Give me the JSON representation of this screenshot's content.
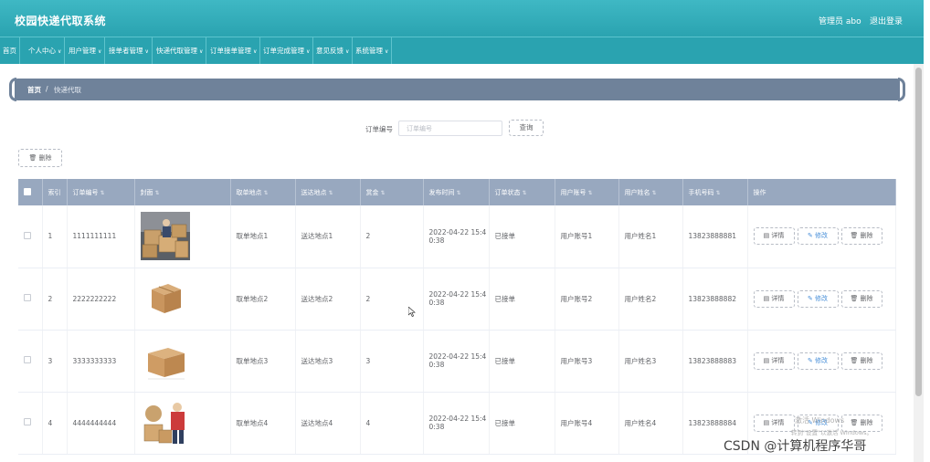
{
  "header": {
    "app_title": "校园快递代取系统",
    "admin": "管理员 abo",
    "logout": "退出登录"
  },
  "nav": [
    {
      "label": "首页",
      "has_dropdown": false
    },
    {
      "label": "个人中心",
      "has_dropdown": true
    },
    {
      "label": "用户管理",
      "has_dropdown": true
    },
    {
      "label": "接单者管理",
      "has_dropdown": true
    },
    {
      "label": "快递代取管理",
      "has_dropdown": true
    },
    {
      "label": "订单接单管理",
      "has_dropdown": true
    },
    {
      "label": "订单完成管理",
      "has_dropdown": true
    },
    {
      "label": "意见反馈",
      "has_dropdown": true
    },
    {
      "label": "系统管理",
      "has_dropdown": true
    }
  ],
  "breadcrumb": {
    "home": "首页",
    "separator": "/",
    "current": "快递代取"
  },
  "search": {
    "label": "订单编号",
    "placeholder": "订单编号",
    "value": "",
    "query_label": "查询"
  },
  "toolbar": {
    "delete_label": "删除"
  },
  "table": {
    "columns": [
      "索引",
      "订单编号",
      "封面",
      "取单地点",
      "送达地点",
      "赏金",
      "发布时间",
      "订单状态",
      "用户账号",
      "用户姓名",
      "手机号码",
      "操作"
    ],
    "rows": [
      {
        "index": "1",
        "order_no": "1111111111",
        "pickup": "取单地点1",
        "dest": "送达地点1",
        "reward": "2",
        "time_a": "2022-04-22 15:4",
        "time_b": "0:38",
        "status": "已接单",
        "account": "用户账号1",
        "name": "用户姓名1",
        "phone": "13823888881"
      },
      {
        "index": "2",
        "order_no": "2222222222",
        "pickup": "取单地点2",
        "dest": "送达地点2",
        "reward": "2",
        "time_a": "2022-04-22 15:4",
        "time_b": "0:38",
        "status": "已接单",
        "account": "用户账号2",
        "name": "用户姓名2",
        "phone": "13823888882"
      },
      {
        "index": "3",
        "order_no": "3333333333",
        "pickup": "取单地点3",
        "dest": "送达地点3",
        "reward": "3",
        "time_a": "2022-04-22 15:4",
        "time_b": "0:38",
        "status": "已接单",
        "account": "用户账号3",
        "name": "用户姓名3",
        "phone": "13823888883"
      },
      {
        "index": "4",
        "order_no": "4444444444",
        "pickup": "取单地点4",
        "dest": "送达地点4",
        "reward": "4",
        "time_a": "2022-04-22 15:4",
        "time_b": "0:38",
        "status": "已接单",
        "account": "用户账号4",
        "name": "用户姓名4",
        "phone": "13823888884"
      }
    ],
    "actions": {
      "detail": "详情",
      "edit": "修改",
      "delete": "删除"
    }
  },
  "overlay": {
    "watermark_line1": "激活 Windows",
    "watermark_line2": "转到\"设置\"以激活 Windows。",
    "credit": "CSDN @计算机程序华哥"
  },
  "icons": {
    "sort": "sort-arrows-icon",
    "detail": "document-icon",
    "edit": "pencil-icon",
    "delete": "trash-icon",
    "dropdown": "chevron-down-icon"
  },
  "colors": {
    "header_bg": "#2aa3b0",
    "breadcrumb_bg": "#6f829a",
    "table_header_bg": "#98a8bf",
    "edit_text": "#4a90d9"
  }
}
